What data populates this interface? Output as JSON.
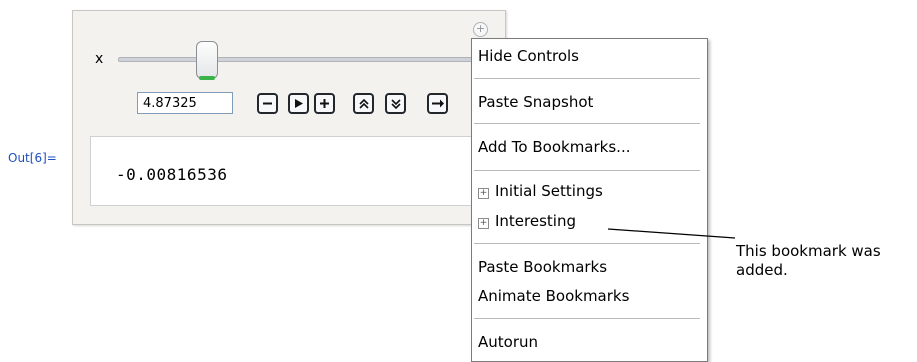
{
  "output_label": "Out[6]=",
  "manipulate": {
    "variable_label": "x",
    "slider_value": "4.87325",
    "control_buttons": [
      {
        "name": "step-down-button",
        "glyph": "minus"
      },
      {
        "name": "play-button",
        "glyph": "play"
      },
      {
        "name": "step-up-button",
        "glyph": "plus"
      },
      {
        "name": "faster-button",
        "glyph": "double-up"
      },
      {
        "name": "slower-button",
        "glyph": "double-down"
      },
      {
        "name": "direction-button",
        "glyph": "arrow-right"
      }
    ],
    "output_value": "-0.00816536"
  },
  "context_menu": {
    "items": [
      {
        "label": "Hide Controls"
      },
      {
        "label": "Paste Snapshot"
      },
      {
        "label": "Add To Bookmarks..."
      },
      {
        "label": "Initial Settings",
        "expandable": true
      },
      {
        "label": "Interesting",
        "expandable": true
      },
      {
        "label": "Paste Bookmarks"
      },
      {
        "label": "Animate Bookmarks"
      },
      {
        "label": "Autorun"
      }
    ]
  },
  "annotation": {
    "text": "This bookmark was\nadded."
  }
}
